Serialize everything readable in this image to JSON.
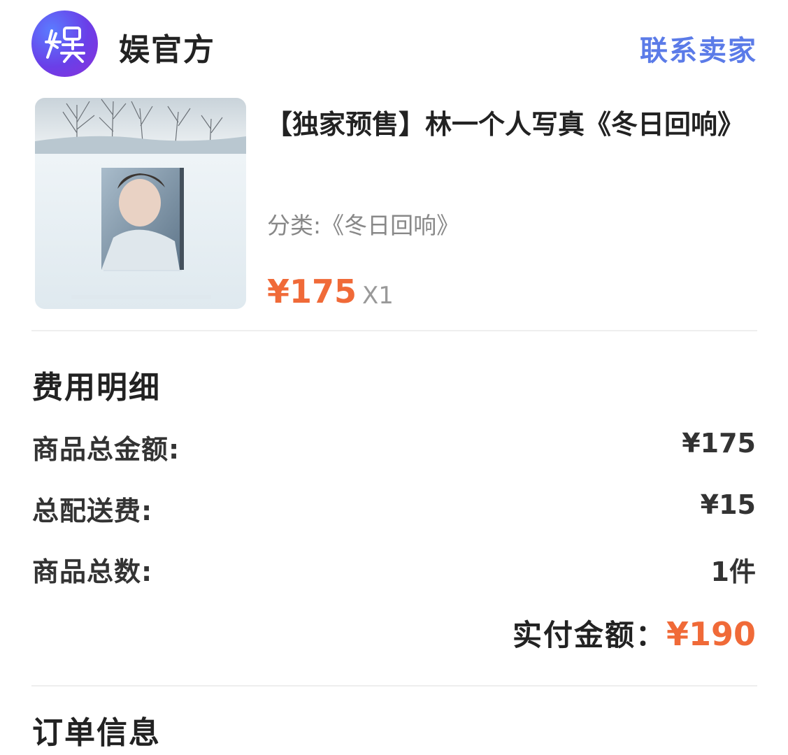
{
  "shop": {
    "logo_glyph": "娱",
    "name": "娱官方",
    "contact_label": "联系卖家"
  },
  "product": {
    "title": "【独家预售】林一个人写真《冬日回响》",
    "category": "分类:《冬日回响》",
    "price": "¥175",
    "quantity": "X1"
  },
  "fees": {
    "title": "费用明细",
    "rows": [
      {
        "label": "商品总金额:",
        "value": "¥175"
      },
      {
        "label": "总配送费:",
        "value": "¥15"
      },
      {
        "label": "商品总数:",
        "value": "1件"
      }
    ],
    "paid_label": "实付金额：",
    "paid_value": "¥190"
  },
  "order_info": {
    "title": "订单信息"
  },
  "colors": {
    "accent_price": "#f06a38",
    "link_blue": "#5b7be8"
  }
}
